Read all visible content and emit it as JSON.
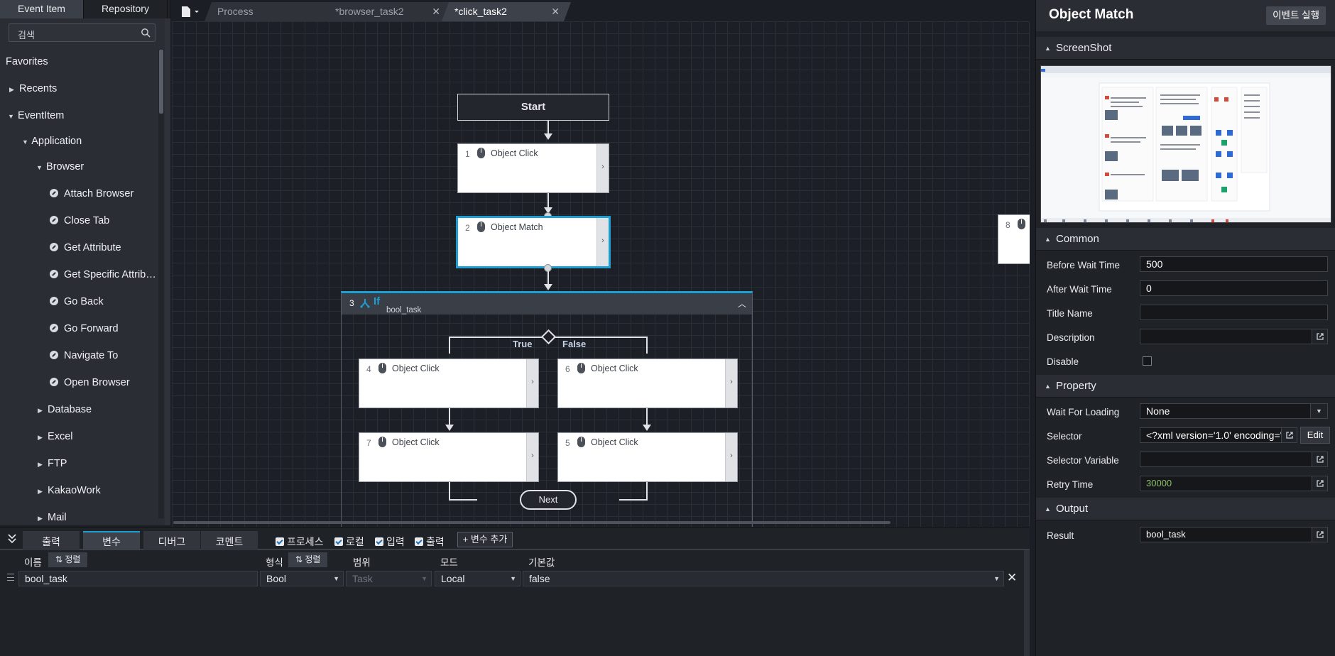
{
  "left_panel": {
    "tabs": [
      "Event Item",
      "Repository"
    ],
    "search_placeholder": "검색",
    "tree": {
      "favorites": "Favorites",
      "recents": "Recents",
      "eventitem": "EventItem",
      "application": "Application",
      "browser": "Browser",
      "browser_items": [
        "Attach Browser",
        "Close Tab",
        "Get Attribute",
        "Get Specific Attrib…",
        "Go Back",
        "Go Forward",
        "Navigate To",
        "Open Browser"
      ],
      "groups": [
        "Database",
        "Excel",
        "FTP",
        "KakaoWork",
        "Mail"
      ]
    }
  },
  "editor": {
    "tabs": [
      {
        "label": "Process",
        "active": false,
        "closable": false
      },
      {
        "label": "*browser_task2",
        "active": false,
        "closable": true
      },
      {
        "label": "*click_task2",
        "active": true,
        "closable": true
      }
    ],
    "close_glyph": "✕"
  },
  "flow": {
    "start": "Start",
    "nodes": [
      {
        "num": "1",
        "title": "Object Click",
        "expand": "›"
      },
      {
        "num": "2",
        "title": "Object Match",
        "expand": "›"
      },
      {
        "num": "4",
        "title": "Object Click",
        "expand": "›"
      },
      {
        "num": "6",
        "title": "Object Click",
        "expand": "›"
      },
      {
        "num": "7",
        "title": "Object Click",
        "expand": "›"
      },
      {
        "num": "5",
        "title": "Object Click",
        "expand": "›"
      },
      {
        "num": "8",
        "title": "",
        "expand": ""
      }
    ],
    "if_block": {
      "num": "3",
      "title": "If",
      "condition": "bool_task",
      "collapse": "︿"
    },
    "true_label": "True",
    "false_label": "False",
    "next": "Next"
  },
  "bottom_panel": {
    "tabs": [
      "출력",
      "변수",
      "디버그",
      "코멘트"
    ],
    "active_tab": "변수",
    "filters": [
      "프로세스",
      "로컬",
      "입력",
      "출력"
    ],
    "add_variable": "+ 변수 추가",
    "headers": {
      "name": "이름",
      "sort": "⇅ 정렬",
      "type": "형식",
      "scope": "범위",
      "mode": "모드",
      "default": "기본값"
    },
    "row": {
      "name": "bool_task",
      "type": "Bool",
      "scope": "Task",
      "mode": "Local",
      "default": "false"
    },
    "remove_glyph": "✕"
  },
  "properties": {
    "title": "Object Match",
    "run_button": "이벤트 실행",
    "sections": {
      "screenshot": "ScreenShot",
      "common": "Common",
      "property": "Property",
      "output": "Output"
    },
    "common": {
      "before_wait_label": "Before Wait Time",
      "before_wait": "500",
      "after_wait_label": "After Wait Time",
      "after_wait": "0",
      "title_name_label": "Title Name",
      "title_name": "",
      "description_label": "Description",
      "description": "",
      "disable_label": "Disable",
      "disable": false
    },
    "property": {
      "wait_for_loading_label": "Wait For Loading",
      "wait_for_loading": "None",
      "selector_label": "Selector",
      "selector": "<?xml version='1.0' encoding='",
      "edit_button": "Edit",
      "selector_variable_label": "Selector Variable",
      "selector_variable": "",
      "retry_time_label": "Retry Time",
      "retry_time": "30000"
    },
    "output": {
      "result_label": "Result",
      "result": "bool_task"
    }
  },
  "colors": {
    "accent": "#1d9fd4",
    "canvas_bg": "#1c1f26",
    "panel_bg": "#2a2d33",
    "retry_green": "#8cc06a"
  }
}
